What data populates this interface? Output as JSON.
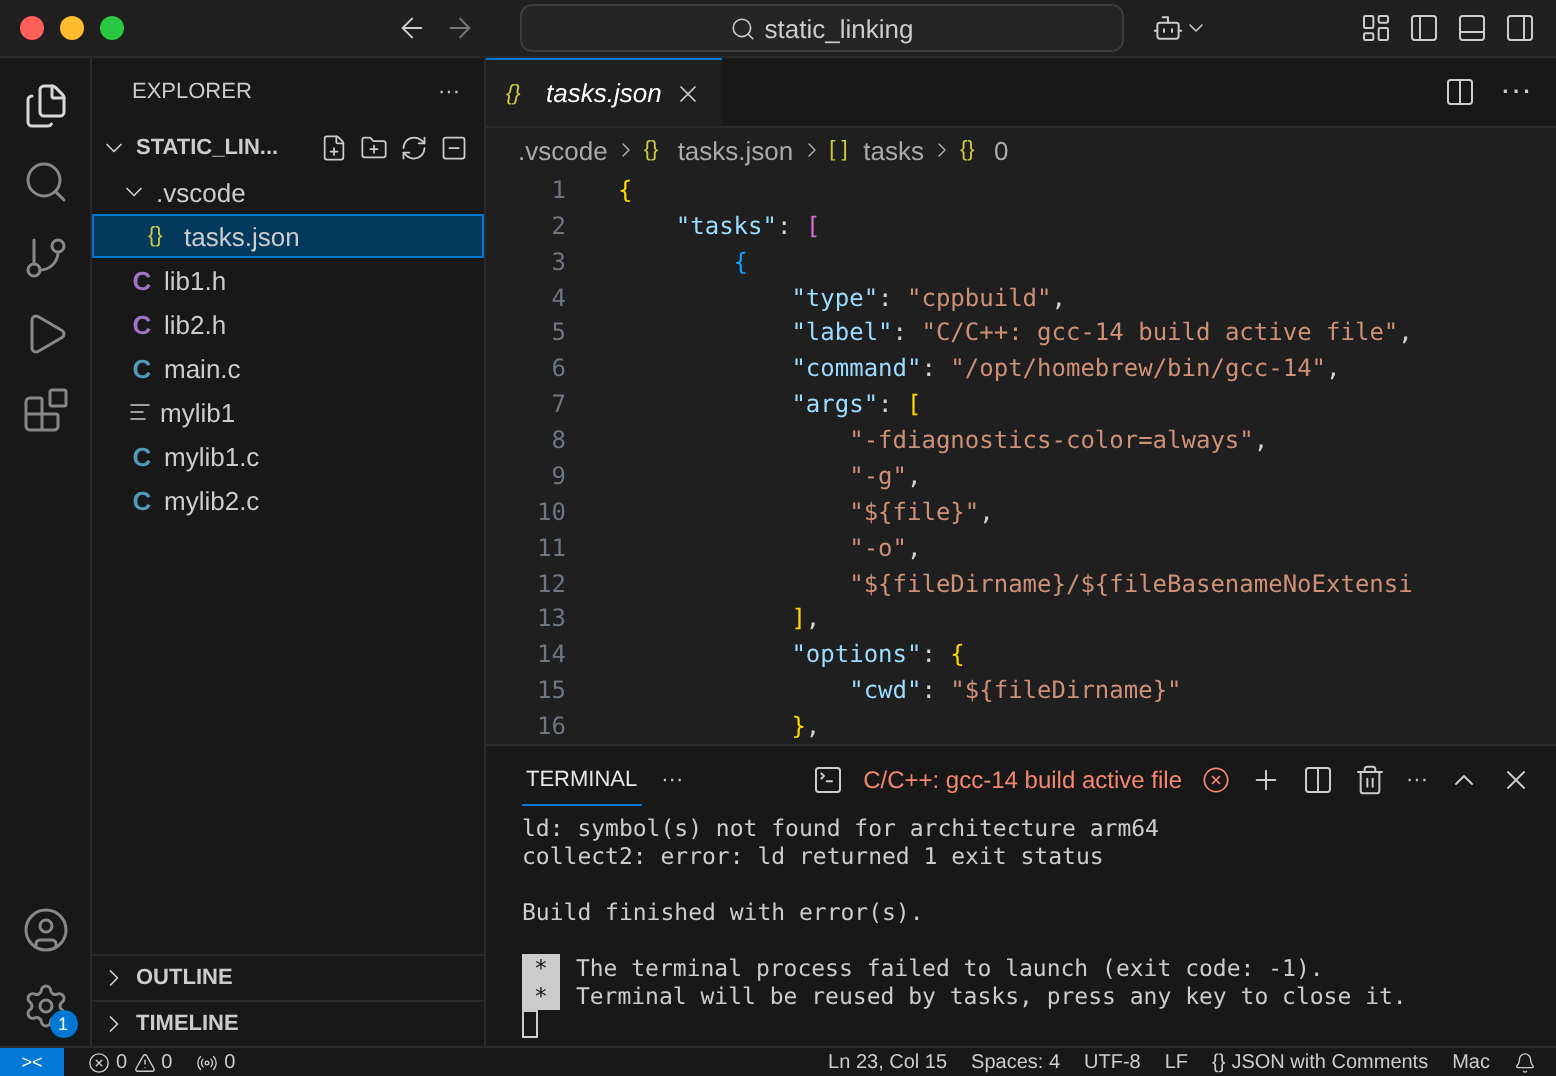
{
  "title_bar": {
    "search": "static_linking"
  },
  "activity_bar": {
    "settings_badge": "1"
  },
  "sidebar": {
    "title": "EXPLORER",
    "more": "···",
    "root": {
      "label": "STATIC_LIN...",
      "expanded": true,
      "children": [
        {
          "label": ".vscode",
          "kind": "folder",
          "expanded": true,
          "selected": false,
          "children": [
            {
              "label": "tasks.json",
              "kind": "json",
              "icon": "{}",
              "selected": true
            }
          ]
        },
        {
          "label": "lib1.h",
          "kind": "header",
          "icon": "C",
          "selected": false
        },
        {
          "label": "lib2.h",
          "kind": "header",
          "icon": "C",
          "selected": false
        },
        {
          "label": "main.c",
          "kind": "c",
          "icon": "C",
          "selected": false
        },
        {
          "label": "mylib1",
          "kind": "text",
          "selected": false
        },
        {
          "label": "mylib1.c",
          "kind": "c",
          "icon": "C",
          "selected": false
        },
        {
          "label": "mylib2.c",
          "kind": "c",
          "icon": "C",
          "selected": false
        }
      ]
    },
    "sections": [
      {
        "label": "OUTLINE",
        "expanded": false
      },
      {
        "label": "TIMELINE",
        "expanded": false
      }
    ]
  },
  "editor": {
    "tabs": [
      {
        "icon": "{}",
        "label": "tasks.json",
        "selected": true
      }
    ],
    "more": "···",
    "breadcrumbs": [
      {
        "label": ".vscode"
      },
      {
        "icon": "{}",
        "label": "tasks.json"
      },
      {
        "icon": "[ ]",
        "label": "tasks"
      },
      {
        "icon": "{}",
        "label": "0"
      }
    ],
    "lines": [
      {
        "number": "1",
        "tokens": [
          {
            "kind": "b1",
            "text": "{"
          }
        ]
      },
      {
        "number": "2",
        "tokens": [
          {
            "kind": "key",
            "text": "    \"tasks\""
          },
          {
            "kind": "punct",
            "text": ": "
          },
          {
            "kind": "b2",
            "text": "["
          }
        ]
      },
      {
        "number": "3",
        "tokens": [
          {
            "kind": "b3",
            "text": "        {"
          }
        ]
      },
      {
        "number": "4",
        "tokens": [
          {
            "kind": "key",
            "text": "            \"type\""
          },
          {
            "kind": "punct",
            "text": ": "
          },
          {
            "kind": "string",
            "text": "\"cppbuild\""
          },
          {
            "kind": "punct",
            "text": ","
          }
        ]
      },
      {
        "number": "5",
        "tokens": [
          {
            "kind": "key",
            "text": "            \"label\""
          },
          {
            "kind": "punct",
            "text": ": "
          },
          {
            "kind": "string",
            "text": "\"C/C++: gcc-14 build active file\""
          },
          {
            "kind": "punct",
            "text": ","
          }
        ]
      },
      {
        "number": "6",
        "tokens": [
          {
            "kind": "key",
            "text": "            \"command\""
          },
          {
            "kind": "punct",
            "text": ": "
          },
          {
            "kind": "string",
            "text": "\"/opt/homebrew/bin/gcc-14\""
          },
          {
            "kind": "punct",
            "text": ","
          }
        ]
      },
      {
        "number": "7",
        "tokens": [
          {
            "kind": "key",
            "text": "            \"args\""
          },
          {
            "kind": "punct",
            "text": ": "
          },
          {
            "kind": "b1",
            "text": "["
          }
        ]
      },
      {
        "number": "8",
        "tokens": [
          {
            "kind": "string",
            "text": "                \"-fdiagnostics-color=always\""
          },
          {
            "kind": "punct",
            "text": ","
          }
        ]
      },
      {
        "number": "9",
        "tokens": [
          {
            "kind": "string",
            "text": "                \"-g\""
          },
          {
            "kind": "punct",
            "text": ","
          }
        ]
      },
      {
        "number": "10",
        "tokens": [
          {
            "kind": "string",
            "text": "                \"${file}\""
          },
          {
            "kind": "punct",
            "text": ","
          }
        ]
      },
      {
        "number": "11",
        "tokens": [
          {
            "kind": "string",
            "text": "                \"-o\""
          },
          {
            "kind": "punct",
            "text": ","
          }
        ]
      },
      {
        "number": "12",
        "tokens": [
          {
            "kind": "string",
            "text": "                \"${fileDirname}/${fileBasenameNoExtensi"
          }
        ]
      },
      {
        "number": "13",
        "tokens": [
          {
            "kind": "b1",
            "text": "            ]"
          },
          {
            "kind": "punct",
            "text": ","
          }
        ]
      },
      {
        "number": "14",
        "tokens": [
          {
            "kind": "key",
            "text": "            \"options\""
          },
          {
            "kind": "punct",
            "text": ": "
          },
          {
            "kind": "b1",
            "text": "{"
          }
        ]
      },
      {
        "number": "15",
        "tokens": [
          {
            "kind": "key",
            "text": "                \"cwd\""
          },
          {
            "kind": "punct",
            "text": ": "
          },
          {
            "kind": "string",
            "text": "\"${fileDirname}\""
          }
        ]
      },
      {
        "number": "16",
        "tokens": [
          {
            "kind": "b1",
            "text": "            }"
          },
          {
            "kind": "punct",
            "text": ","
          }
        ]
      }
    ]
  },
  "panel": {
    "tabs": [
      {
        "label": "TERMINAL",
        "selected": true
      }
    ],
    "more": "···",
    "task": {
      "label": "C/C++: gcc-14 build active file",
      "failed": true
    },
    "actions_more": "···",
    "lines": [
      {
        "kind": "text",
        "text": "ld: symbol(s) not found for architecture arm64"
      },
      {
        "kind": "text",
        "text": "collect2: error: ld returned 1 exit status"
      },
      {
        "kind": "blank"
      },
      {
        "kind": "text",
        "text": "Build finished with error(s)."
      },
      {
        "kind": "blank"
      },
      {
        "kind": "star",
        "mark": "*",
        "text": "The terminal process failed to launch (exit code: -1)."
      },
      {
        "kind": "star",
        "mark": "*",
        "text": "Terminal will be reused by tasks, press any key to close it."
      },
      {
        "kind": "cursor"
      }
    ]
  },
  "status_bar": {
    "remote": "><",
    "errors": "0",
    "warnings": "0",
    "ports": "0",
    "position": "Ln 23, Col 15",
    "indent": "Spaces: 4",
    "encoding": "UTF-8",
    "eol": "LF",
    "language_icon": "{}",
    "language": "JSON with Comments",
    "platform": "Mac"
  }
}
